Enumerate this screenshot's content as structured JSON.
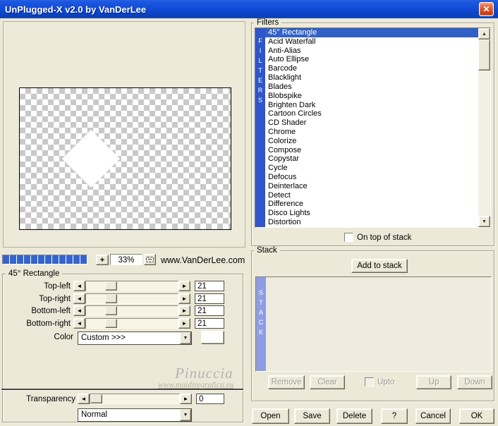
{
  "window": {
    "title": "UnPlugged-X v2.0 by VanDerLee",
    "close_glyph": "✕"
  },
  "toolbar": {
    "plus_label": "+",
    "zoom_value": "33%",
    "vendor_url": "www.VanDerLee.com",
    "progress_segments": 12
  },
  "icons": {
    "left_arrow": "◄",
    "right_arrow": "►",
    "up_arrow": "▲",
    "down_arrow": "▼",
    "dropdown_arrow": "▼"
  },
  "filters_group": {
    "label": "Filters",
    "vertical_label": "FILTERS",
    "selected_index": 0,
    "items": [
      "45° Rectangle",
      "Acid Waterfall",
      "Anti-Alias",
      "Auto Ellipse",
      "Barcode",
      "Blacklight",
      "Blades",
      "Blobspike",
      "Brighten Dark",
      "Cartoon Circles",
      "CD Shader",
      "Chrome",
      "Colorize",
      "Compose",
      "Copystar",
      "Cycle",
      "Defocus",
      "Deinterlace",
      "Detect",
      "Difference",
      "Disco Lights",
      "Distortion"
    ],
    "on_top_label": "On top of stack",
    "on_top_checked": false
  },
  "params_group": {
    "label": "45° Rectangle",
    "sliders": [
      {
        "label": "Top-left",
        "value": "21"
      },
      {
        "label": "Top-right",
        "value": "21"
      },
      {
        "label": "Bottom-left",
        "value": "21"
      },
      {
        "label": "Bottom-right",
        "value": "21"
      }
    ],
    "color_label": "Color",
    "color_value": "Custom >>>",
    "color_swatch": "#ffffff",
    "transparency_label": "Transparency",
    "transparency_value": "0",
    "blend_mode_value": "Normal"
  },
  "stack_group": {
    "label": "Stack",
    "vertical_label": "STACK",
    "add_button": "Add to stack",
    "items": [],
    "remove_button": "Remove",
    "clear_button": "Clear",
    "upto_label": "Upto",
    "upto_checked": false,
    "up_button": "Up",
    "down_button": "Down"
  },
  "watermark": {
    "name": "Pinuccia",
    "site": "www.maidiregrafica.eu"
  },
  "footer": {
    "buttons": [
      "Open",
      "Save",
      "Delete",
      "?",
      "Cancel",
      "OK"
    ]
  },
  "colors": {
    "dialog_bg": "#ece9d8",
    "titlebar_blue": "#0f4ad4",
    "selection_blue": "#3161c6",
    "filters_bar_blue": "#2f55cb",
    "stack_bar_periwinkle": "#8f9ee2",
    "progress_blue": "#3465cc",
    "close_red": "#cf3c12"
  }
}
